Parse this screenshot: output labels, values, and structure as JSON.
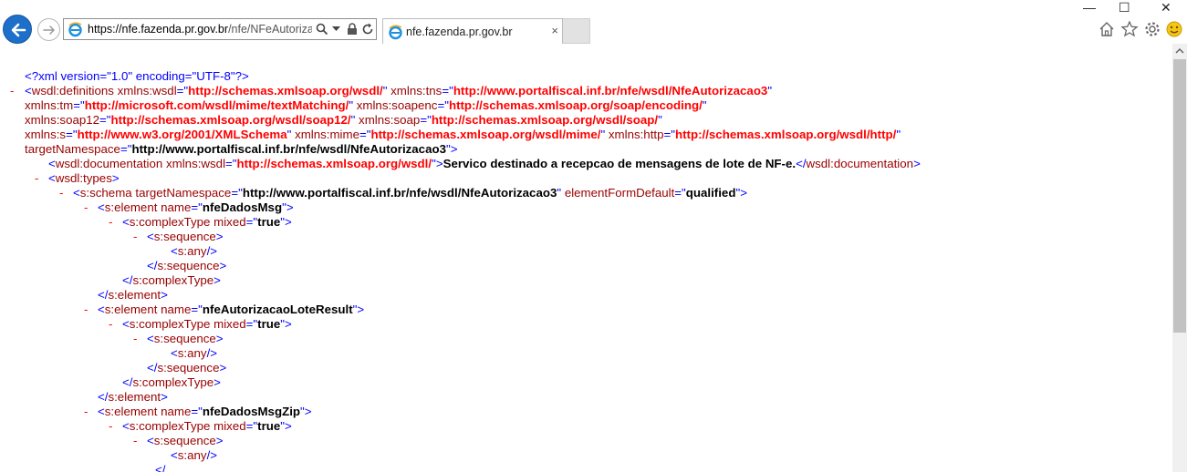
{
  "browser": {
    "url_scheme": "https://",
    "url_domain": "nfe.fazenda.pr.gov.br",
    "url_rest": "/nfe/NFeAutorizac",
    "tab_title": "nfe.fazenda.pr.gov.br",
    "tab_close": "×",
    "win_minimize": "—",
    "win_maximize": "☐",
    "win_close": "✕",
    "icons": [
      "back-arrow-icon",
      "forward-arrow-icon",
      "ie-logo-icon",
      "search-icon",
      "dropdown-icon",
      "lock-icon",
      "refresh-icon",
      "home-icon",
      "favorites-star-icon",
      "settings-gear-icon",
      "smiley-feedback-icon"
    ]
  },
  "xml_lines": [
    {
      "t": "<?xml version=\"1.0\" encoding=\"UTF-8\"?>"
    },
    {
      "t": "<wsdl:definitions xmlns:wsdl=\"http://schemas.xmlsoap.org/wsdl/\" xmlns:tns=\"http://www.portalfiscal.inf.br/nfe/wsdl/NfeAutorizacao3\""
    },
    {
      "t": "xmlns:tm=\"http://microsoft.com/wsdl/mime/textMatching/\" xmlns:soapenc=\"http://schemas.xmlsoap.org/soap/encoding/\""
    },
    {
      "t": "xmlns:soap12=\"http://schemas.xmlsoap.org/wsdl/soap12/\" xmlns:soap=\"http://schemas.xmlsoap.org/wsdl/soap/\""
    },
    {
      "t": "xmlns:s=\"http://www.w3.org/2001/XMLSchema\" xmlns:mime=\"http://schemas.xmlsoap.org/wsdl/mime/\" xmlns:http=\"http://schemas.xmlsoap.org/wsdl/http/\""
    },
    {
      "t": "targetNamespace=\"http://www.portalfiscal.inf.br/nfe/wsdl/NfeAutorizacao3\">"
    },
    {
      "t": "<wsdl:documentation xmlns:wsdl=\"http://schemas.xmlsoap.org/wsdl/\">Servico destinado a recepcao de mensagens de lote de NF-e.</wsdl:documentation>"
    },
    {
      "t": "<wsdl:types>"
    },
    {
      "t": "<s:schema targetNamespace=\"http://www.portalfiscal.inf.br/nfe/wsdl/NfeAutorizacao3\" elementFormDefault=\"qualified\">"
    },
    {
      "t": "<s:element name=\"nfeDadosMsg\">"
    },
    {
      "t": "<s:complexType mixed=\"true\">"
    },
    {
      "t": "<s:sequence>"
    },
    {
      "t": "<s:any/>"
    },
    {
      "t": "</s:sequence>"
    },
    {
      "t": "</s:complexType>"
    },
    {
      "t": "</s:element>"
    },
    {
      "t": "<s:element name=\"nfeAutorizacaoLoteResult\">"
    },
    {
      "t": "<s:complexType mixed=\"true\">"
    },
    {
      "t": "<s:sequence>"
    },
    {
      "t": "<s:any/>"
    },
    {
      "t": "</s:sequence>"
    },
    {
      "t": "</s:complexType>"
    },
    {
      "t": "</s:element>"
    },
    {
      "t": "<s:element name=\"nfeDadosMsgZip\">"
    },
    {
      "t": "<s:complexType mixed=\"true\">"
    },
    {
      "t": "<s:sequence>"
    },
    {
      "t": "<s:any/>"
    },
    {
      "t": "</"
    }
  ],
  "minus_marker": "-",
  "colors": {
    "tag": "#990000",
    "pi": "#0000ff",
    "ns": "#ff0000",
    "value": "#000000",
    "accent": "#1e6fc9"
  }
}
